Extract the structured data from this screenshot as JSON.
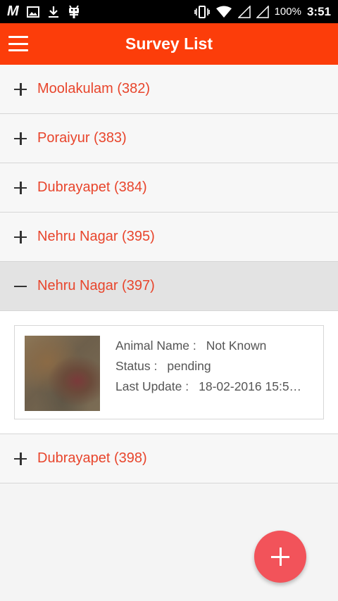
{
  "status_bar": {
    "left_icons": [
      "gmail-icon",
      "image-icon",
      "download-icon",
      "android-debug-icon"
    ],
    "right_icons": [
      "vibrate-icon",
      "wifi-icon",
      "signal-icon",
      "signal-icon"
    ],
    "battery": "100%",
    "time": "3:51"
  },
  "app_bar": {
    "title": "Survey List",
    "menu_icon": "hamburger-menu-icon",
    "color": "#fc3d0a"
  },
  "groups": [
    {
      "label": "Moolakulam (382)",
      "expanded": false
    },
    {
      "label": "Poraiyur (383)",
      "expanded": false
    },
    {
      "label": "Dubrayapet (384)",
      "expanded": false
    },
    {
      "label": "Nehru Nagar (395)",
      "expanded": false
    },
    {
      "label": "Nehru Nagar (397)",
      "expanded": true,
      "items": [
        {
          "animal_name_label": "Animal Name :",
          "animal_name": "Not Known",
          "status_label": "Status :",
          "status": "pending",
          "last_update_label": "Last Update :",
          "last_update": "18-02-2016 15:5…"
        }
      ]
    },
    {
      "label": "Dubrayapet (398)",
      "expanded": false
    }
  ],
  "fab": {
    "icon": "plus-icon",
    "color": "#f2535a"
  },
  "colors": {
    "accent": "#e8452c",
    "fab": "#f2535a"
  }
}
